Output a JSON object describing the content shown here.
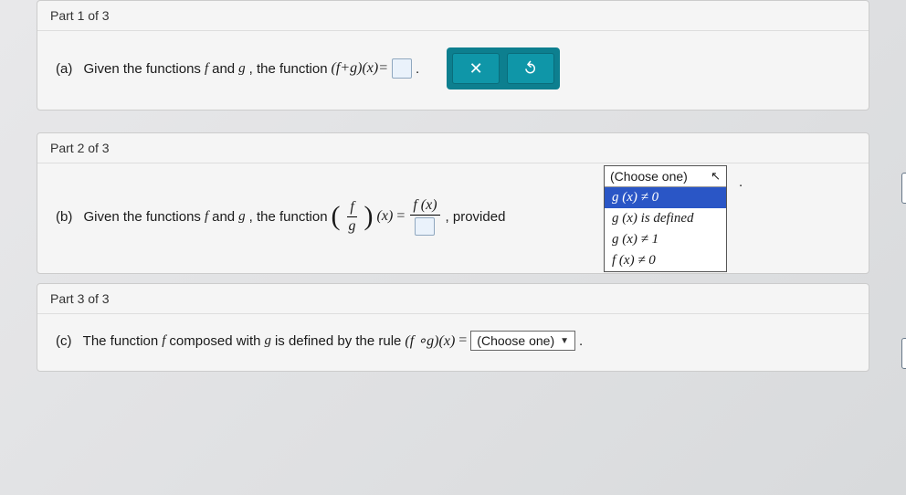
{
  "part1": {
    "header": "Part 1 of 3",
    "label": "(a)",
    "text1": "Given the functions ",
    "f": "f",
    "text2": " and ",
    "g": "g",
    "text3": ", the function ",
    "expr": "(f+g)(x)=",
    "period": "."
  },
  "part2": {
    "header": "Part 2 of 3",
    "label": "(b)",
    "text1": "Given the functions ",
    "f": "f",
    "text2": " and ",
    "g": "g",
    "text3": ", the function ",
    "frac_num": "f",
    "frac_den": "g",
    "expr_tail": "(x)",
    "eq": " = ",
    "rhs_num": "f (x)",
    "comma": ", provided ",
    "dropdown_placeholder": "(Choose one)",
    "options": {
      "o1": "g (x) ≠ 0",
      "o2": "g (x) is defined",
      "o3": "g (x) ≠ 1",
      "o4": "f (x) ≠ 0"
    },
    "period": "."
  },
  "part3": {
    "header": "Part 3 of 3",
    "label": "(c)",
    "text1": "The function ",
    "f": "f",
    "text2": " composed with ",
    "g": "g",
    "text3": " is defined by the rule ",
    "expr": "(f ∘g)(x)",
    "eq": " = ",
    "dropdown_placeholder": "(Choose one)",
    "period": "."
  },
  "buttons": {
    "x": "✕",
    "reset": "↻"
  }
}
